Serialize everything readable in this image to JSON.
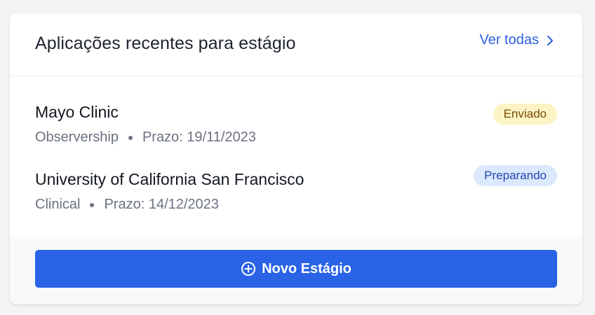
{
  "card": {
    "title": "Aplicações recentes para estágio",
    "view_all_label": "Ver todas",
    "view_all_icon": "chevron-right-icon"
  },
  "applications": [
    {
      "name": "Mayo Clinic",
      "type": "Observership",
      "deadline": "Prazo: 19/11/2023",
      "status": "Enviado",
      "status_color": "#fcf4c4"
    },
    {
      "name": "University of California San Francisco",
      "type": "Clinical",
      "deadline": "Prazo: 14/12/2023",
      "status": "Preparando",
      "status_color": "#dce8fb"
    }
  ],
  "footer": {
    "new_button_label": "Novo Estágio",
    "new_button_icon": "plus-circle-icon",
    "accent_color": "#2a63e6"
  }
}
